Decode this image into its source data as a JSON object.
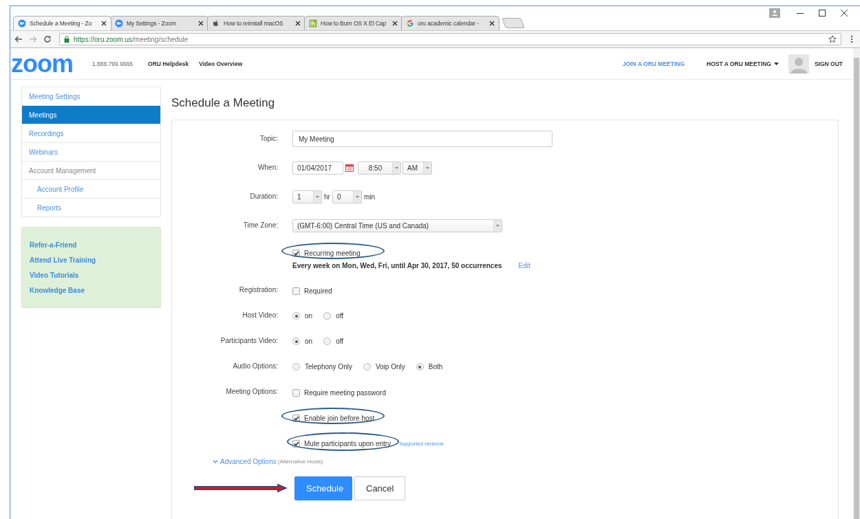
{
  "browser": {
    "tabs": [
      {
        "title": "Schedule a Meeting - Zo",
        "kind": "zoom",
        "selected": true
      },
      {
        "title": "My Settings - Zoom",
        "kind": "zoom",
        "selected": false
      },
      {
        "title": "How to reinstall macOS",
        "kind": "apple",
        "selected": false
      },
      {
        "title": "How to Burn OS X El Cap",
        "kind": "lh",
        "selected": false
      },
      {
        "title": "oru academic calendar -",
        "kind": "google",
        "selected": false
      }
    ],
    "url_scheme_host": "https://oru.zoom.us",
    "url_path": "/meeting/schedule"
  },
  "header": {
    "logo": "zoom",
    "phone": "1.888.799.9666",
    "links": [
      "ORU Helpdesk",
      "Video Overview"
    ],
    "join": "JOIN A ORU MEETING",
    "host": "HOST A ORU MEETING",
    "sign_out": "SIGN OUT"
  },
  "sidebar": {
    "items": [
      {
        "label": "Meeting Settings",
        "selected": false
      },
      {
        "label": "Meetings",
        "selected": true
      },
      {
        "label": "Recordings",
        "selected": false
      },
      {
        "label": "Webinars",
        "selected": false
      },
      {
        "label": "Account Management",
        "selected": false,
        "children": [
          {
            "label": "Account Profile",
            "selected": false
          },
          {
            "label": "Reports",
            "selected": false
          }
        ]
      }
    ],
    "help_links": [
      "Refer-a-Friend",
      "Attend Live Training",
      "Video Tutorials",
      "Knowledge Base"
    ]
  },
  "form": {
    "title": "Schedule a Meeting",
    "rows": [
      {
        "kind": "text",
        "label": "Topic:",
        "value": "My Meeting"
      },
      {
        "kind": "when",
        "label": "When:",
        "date": "01/04/2017",
        "time": "8:50",
        "ampm": "AM"
      },
      {
        "kind": "duration",
        "label": "Duration:",
        "hours": "1",
        "hours_unit": "hr",
        "minutes": "0",
        "minutes_unit": "min"
      },
      {
        "kind": "select",
        "label": "Time Zone:",
        "value": "(GMT-6:00) Central Time (US and Canada)"
      },
      {
        "kind": "checks",
        "options": [
          {
            "label": "Recurring meeting",
            "checked": true,
            "circled": true
          }
        ],
        "note": "Every week on Mon, Wed, Fri, until Apr 30, 2017, 50 occurrences",
        "note_link": "Edit"
      },
      {
        "kind": "checks",
        "label": "Registration:",
        "options": [
          {
            "label": "Required",
            "checked": false,
            "circled": false
          }
        ]
      },
      {
        "kind": "radios",
        "label": "Host Video:",
        "options": [
          {
            "label": "on",
            "selected": true
          },
          {
            "label": "off",
            "selected": false
          }
        ]
      },
      {
        "kind": "radios",
        "label": "Participants Video:",
        "options": [
          {
            "label": "on",
            "selected": true
          },
          {
            "label": "off",
            "selected": false
          }
        ]
      },
      {
        "kind": "radios",
        "label": "Audio Options:",
        "options": [
          {
            "label": "Telephony Only",
            "selected": false
          },
          {
            "label": "Voip Only",
            "selected": false
          },
          {
            "label": "Both",
            "selected": true
          }
        ]
      },
      {
        "kind": "checks",
        "label": "Meeting Options:",
        "options": [
          {
            "label": "Require meeting password",
            "checked": false,
            "circled": false
          },
          {
            "label": "Enable join before host",
            "checked": true,
            "circled": true
          },
          {
            "label": "Mute participants upon entry",
            "checked": true,
            "circled": true,
            "link": "Supported versions"
          }
        ]
      }
    ],
    "advanced": {
      "label": "Advanced Options",
      "hint": "(Alternative Hosts)"
    },
    "buttons": [
      {
        "label": "Schedule",
        "kind": "primary",
        "arrow": true
      },
      {
        "label": "Cancel",
        "kind": "default",
        "arrow": false
      }
    ]
  }
}
